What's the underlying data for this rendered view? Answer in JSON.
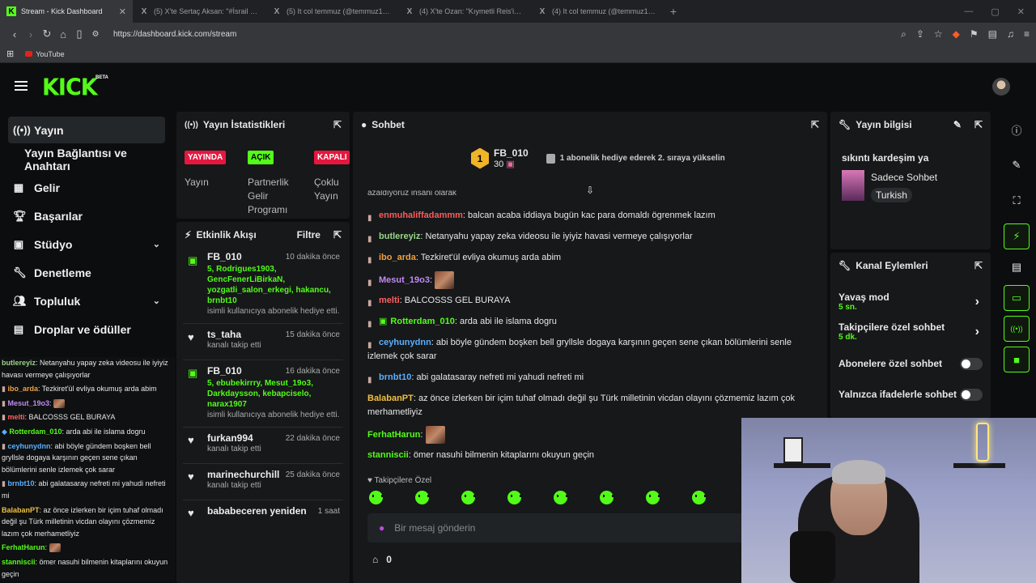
{
  "browser": {
    "tabs": [
      {
        "icon": "K",
        "label": "Stream - Kick Dashboard",
        "active": true
      },
      {
        "icon": "X",
        "label": "(5) X'te Sertaç Aksan: \"#İsrail 🔴 Ara"
      },
      {
        "icon": "X",
        "label": "(5) It col temmuz (@temmuz1919) / X"
      },
      {
        "icon": "X",
        "label": "(4) X'te Ozan: \"Kıymetli Reis'im bu ol"
      },
      {
        "icon": "X",
        "label": "(4) It col temmuz (@temmuz1919) / X"
      }
    ],
    "url": "https://dashboard.kick.com/stream",
    "bookmark": "YouTube"
  },
  "kick": {
    "logo": "KICK",
    "beta": "BETA"
  },
  "sidebar": {
    "items": [
      {
        "label": "Yayın",
        "icon": "broadcast-icon"
      },
      {
        "label": "Yayın Bağlantısı ve Anahtarı"
      },
      {
        "label": "Gelir",
        "icon": "chart-icon"
      },
      {
        "label": "Başarılar",
        "icon": "trophy-icon"
      },
      {
        "label": "Stüdyo",
        "icon": "film-icon"
      },
      {
        "label": "Denetleme",
        "icon": "wrench-icon"
      },
      {
        "label": "Topluluk",
        "icon": "people-icon"
      },
      {
        "label": "Droplar ve ödüller",
        "icon": "drops-icon"
      }
    ]
  },
  "overlay_chat": [
    {
      "user": "butlereyiz",
      "color": "#9ad48a",
      "text": ": Netanyahu yapay zeka videosu ile iyiyiz havası vermeye çalışıyorlar"
    },
    {
      "user": "ibo_arda",
      "color": "#f0a040",
      "text": ": Tezkiret'ül evliya okumuş arda abim"
    },
    {
      "user": "Mesut_19o3",
      "color": "#c08af0",
      "text": ":"
    },
    {
      "user": "melti",
      "color": "#ff6060",
      "text": ": BALCOSSS GEL BURAYA"
    },
    {
      "user": "Rotterdam_010",
      "color": "#53fc18",
      "text": ": arda abi ile islama dogru"
    },
    {
      "user": "ceyhunydnn",
      "color": "#5ab0ff",
      "text": ": abi böyle gündem boşken bell gryllsle dogaya karşının geçen sene çıkan bölümlerini senle izlemek çok sarar"
    },
    {
      "user": "brnbt10",
      "color": "#5ab0ff",
      "text": ": abi galatasaray nefreti mi yahudi nefreti mi"
    },
    {
      "user": "BalabanPT",
      "color": "#f0c040",
      "text": ": az önce izlerken bir içim tuhaf olmadı değil şu Türk milletinin vicdan olayını çözmemiz lazım çok merhametliyiz"
    },
    {
      "user": "FerhatHarun",
      "color": "#53fc18",
      "text": ":"
    },
    {
      "user": "stanniscii",
      "color": "#53fc18",
      "text": ": ömer nasuhi bilmenin kitaplarını okuyun geçin"
    }
  ],
  "stats": {
    "title": "Yayın İstatistikleri",
    "items": [
      {
        "badge": "YAYINDA",
        "badge_color": "#e5173f",
        "label": "Yayın"
      },
      {
        "badge": "AÇIK",
        "badge_color": "#53fc18",
        "label": "Partnerlik Gelir Programı"
      },
      {
        "badge": "KAPALI",
        "badge_color": "#e5173f",
        "label": "Çoklu Yayın"
      }
    ]
  },
  "activity": {
    "title": "Etkinlik Akışı",
    "filter": "Filtre",
    "items": [
      {
        "icon": "gift-icon",
        "name": "FB_010",
        "time": "10 dakika önce",
        "list": "5, Rodrigues1903, GencFenerLiBirkaN, yozgatli_salon_erkegi, hakancu, brnbt10",
        "desc": "isimli kullanıcıya abonelik hediye etti."
      },
      {
        "icon": "heart-icon",
        "name": "ts_taha",
        "time": "15 dakika önce",
        "list": "",
        "desc": "kanalı takip etti"
      },
      {
        "icon": "gift-icon",
        "name": "FB_010",
        "time": "16 dakika önce",
        "list": "5, ebubekirrry, Mesut_19o3, Darkdaysson, kebapciselo, narax1907",
        "desc": "isimli kullanıcıya abonelik hediye etti."
      },
      {
        "icon": "heart-icon",
        "name": "furkan994",
        "time": "22 dakika önce",
        "list": "",
        "desc": "kanalı takip etti"
      },
      {
        "icon": "heart-icon",
        "name": "marinechurchill",
        "time": "25 dakika önce",
        "list": "",
        "desc": "kanalı takip etti"
      },
      {
        "icon": "heart-icon",
        "name": "bababeceren yeniden",
        "time": "1 saat",
        "list": "",
        "desc": ""
      }
    ]
  },
  "chat": {
    "title": "Sohbet",
    "top_gifter": {
      "rank": "1",
      "name": "FB_010",
      "count": "30",
      "hint": "1 abonelik hediye ederek 2. sıraya yükselin"
    },
    "cut_line": "azaldıyoruz insani olarak",
    "messages": [
      {
        "user": "enmuhaliffadammm",
        "color": "#ff5a5a",
        "text": ": balcan acaba iddiaya bugün kac para domaldı ögrenmek lazım",
        "icon": true
      },
      {
        "user": "butlereyiz",
        "color": "#9ad48a",
        "text": ": Netanyahu yapay zeka videosu ile iyiyiz havasi vermeye çalışıyorlar",
        "icon": true
      },
      {
        "user": "ibo_arda",
        "color": "#f0a040",
        "text": ": Tezkiret'ül evliya okumuş arda abim",
        "icon": true
      },
      {
        "user": "Mesut_19o3",
        "color": "#c08af0",
        "text": ":",
        "icon": true,
        "emote": true
      },
      {
        "user": "melti",
        "color": "#ff6060",
        "text": ": BALCOSSS GEL BURAYA",
        "icon": true
      },
      {
        "user": "Rotterdam_010",
        "color": "#53fc18",
        "text": ": arda abi ile islama dogru",
        "icon": true
      },
      {
        "user": "ceyhunydnn",
        "color": "#5ab0ff",
        "text": ": abi böyle gündem boşken bell gryllsle dogaya karşının geçen sene çıkan bölümlerini senle izlemek çok sarar",
        "icon": true
      },
      {
        "user": "brnbt10",
        "color": "#5ab0ff",
        "text": ": abi galatasaray nefreti mi yahudi nefreti mi",
        "icon": true
      },
      {
        "user": "BalabanPT",
        "color": "#f0c040",
        "text": ": az önce izlerken bir içim tuhaf olmadı değil şu Türk milletinin vicdan olayını çözmemiz lazım çok merhametliyiz",
        "icon": false
      },
      {
        "user": "FerhatHarun",
        "color": "#53fc18",
        "text": ":",
        "icon": false,
        "emote": true
      },
      {
        "user": "stanniscii",
        "color": "#53fc18",
        "text": ": ömer nasuhi bilmenin kitaplarını okuyun geçin",
        "icon": false
      }
    ],
    "followers_only": "Takipçilere Özel",
    "input_placeholder": "Bir mesaj gönderin",
    "points": "0"
  },
  "stream_info": {
    "title": "Yayın bilgisi",
    "stream_title": "sıkıntı kardeşim ya",
    "category": "Sadece Sohbet",
    "language": "Turkish"
  },
  "channel_actions": {
    "title": "Kanal Eylemleri",
    "items": [
      {
        "label": "Yavaş mod",
        "sub": "5 sn.",
        "type": "arrow"
      },
      {
        "label": "Takipçilere özel sohbet",
        "sub": "5 dk.",
        "type": "arrow"
      },
      {
        "label": "Abonelere özel sohbet",
        "sub": "",
        "type": "toggle"
      },
      {
        "label": "Yalnızca ifadelerle sohbet",
        "sub": "",
        "type": "toggle"
      }
    ]
  }
}
